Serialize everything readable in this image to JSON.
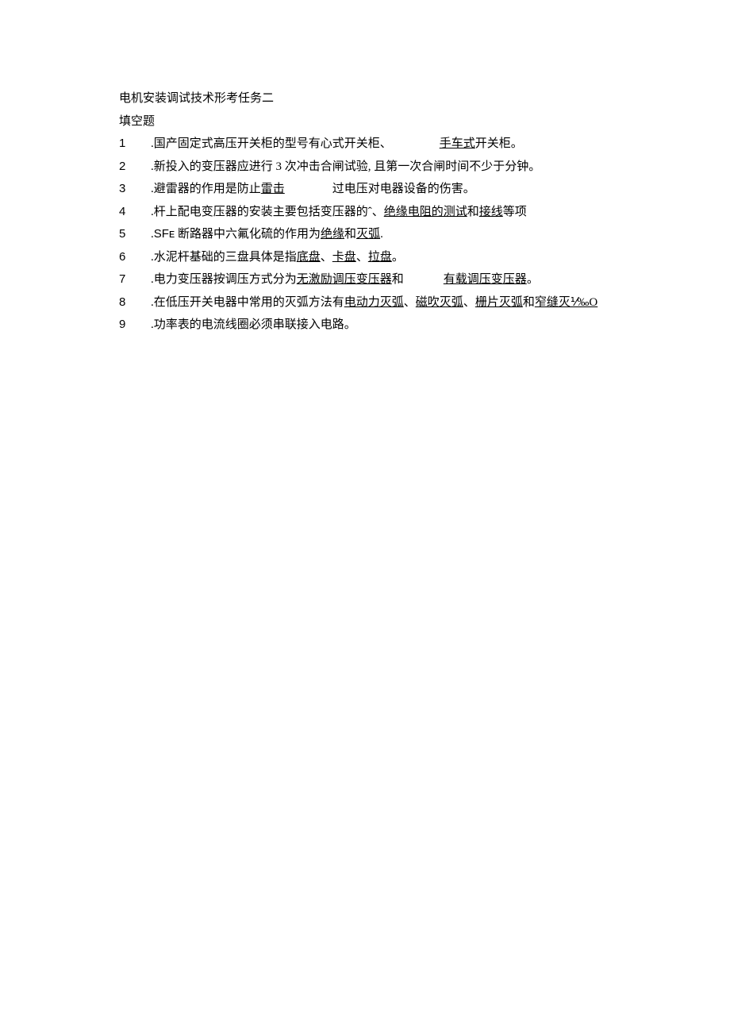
{
  "title": "电机安装调试技术形考任务二",
  "subtitle": "填空题",
  "items": [
    {
      "pre": ".国产固定式高压开关柜的型号有心式开关柜、",
      "gap": "gap-small",
      "u1": "手车式",
      "post": "开关柜。"
    },
    {
      "pre": ".新投入的变压器应进行 3 次冲击合闸试验, 且第一次合闸时间不少于分钟。"
    },
    {
      "pre": ".避雷器的作用是防止",
      "u1": "雷击",
      "gap": "gap-small",
      "post": "过电压对电器设备的伤害。"
    },
    {
      "pre": ".杆上配电变压器的安装主要包括变压器的ˆ、",
      "u1": "绝缘电阻的测试",
      "mid1": "和",
      "u2": "接线",
      "post": "等项"
    },
    {
      "pre_raw": ".<span class=\"arial\">SFᴇ</span> 断路器中六氟化硫的作用为",
      "u1": "绝缘",
      "mid1": "和",
      "u2": "灭弧",
      "post": "."
    },
    {
      "pre": ".水泥杆基础的三盘具体是指",
      "u1": "底盘",
      "mid1": "、",
      "u2": "卡盘",
      "mid2": "、",
      "u3": "拉盘",
      "post": "。"
    },
    {
      "pre": ".电力变压器按调压方式分为",
      "u1": "无激励调压变压器",
      "mid1": "和",
      "gap": "gap-med",
      "u2": "有载调压变压器",
      "post": "。"
    },
    {
      "pre": ".在低压开关电器中常用的灭弧方法有",
      "u1": "电动力灭弧",
      "mid1": "、",
      "u2": "磁吹灭弧",
      "mid2": "、",
      "u3": "栅片灭弧",
      "mid3": "和",
      "u4": "窄缝灭⅟‰O"
    },
    {
      "pre": ".功率表的电流线圈必须串联接入电路。"
    }
  ]
}
